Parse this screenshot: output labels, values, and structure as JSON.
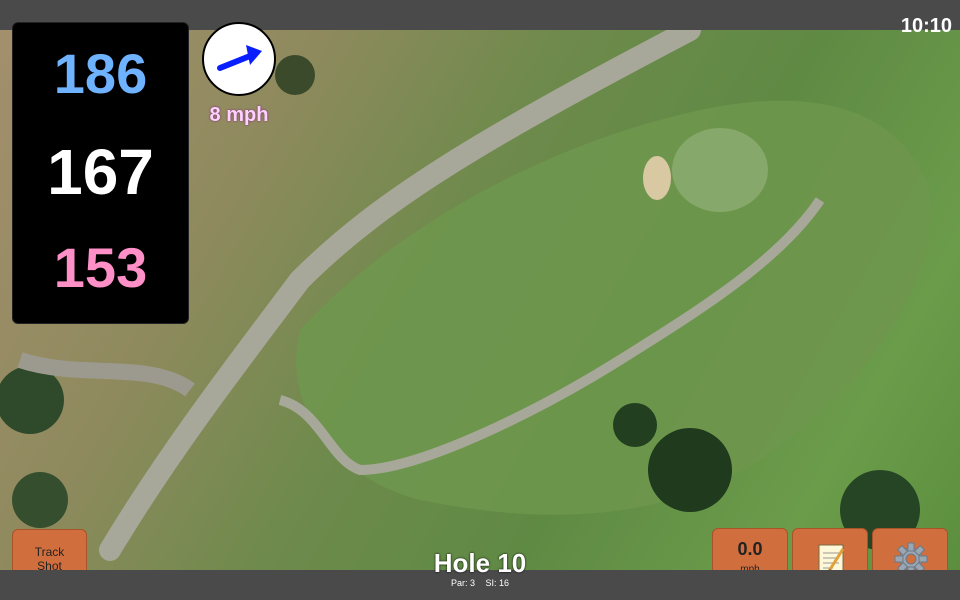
{
  "status": {
    "time": "10:10"
  },
  "yardages": {
    "back": "186",
    "middle": "167",
    "front": "153"
  },
  "wind": {
    "speed": "8 mph",
    "direction_icon": "arrow-right-up-icon"
  },
  "buttons": {
    "track_shot": {
      "line1": "Track",
      "line2": "Shot"
    },
    "speed": {
      "value": "0.0",
      "unit": "mph"
    },
    "notes": {
      "icon": "notepad-icon"
    },
    "settings": {
      "icon": "gear-icon"
    }
  },
  "hole": {
    "title": "Hole 10",
    "par": "Par: 3",
    "si": "SI: 16"
  },
  "colors": {
    "back": "#6fb2ff",
    "middle": "#ffffff",
    "front": "#ff8fc7",
    "button": "#d06f3d"
  }
}
